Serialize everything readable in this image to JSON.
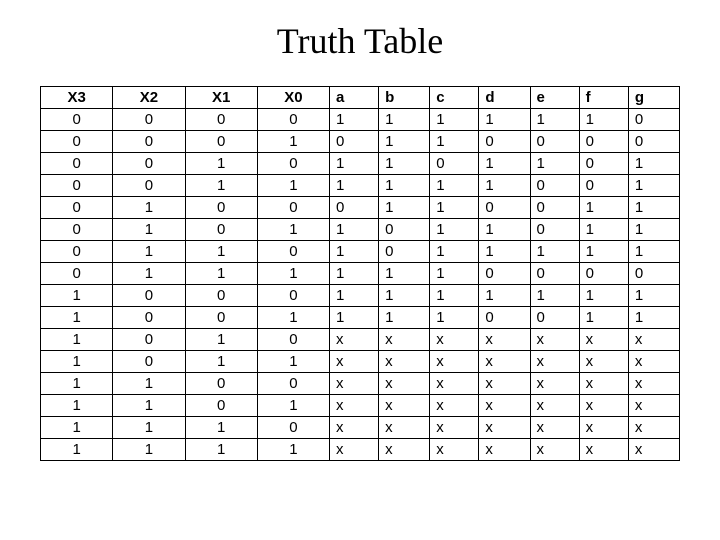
{
  "title": "Truth Table",
  "chart_data": {
    "type": "table",
    "headers": [
      "X3",
      "X2",
      "X1",
      "X0",
      "a",
      "b",
      "c",
      "d",
      "e",
      "f",
      "g"
    ],
    "rows": [
      [
        "0",
        "0",
        "0",
        "0",
        "1",
        "1",
        "1",
        "1",
        "1",
        "1",
        "0"
      ],
      [
        "0",
        "0",
        "0",
        "1",
        "0",
        "1",
        "1",
        "0",
        "0",
        "0",
        "0"
      ],
      [
        "0",
        "0",
        "1",
        "0",
        "1",
        "1",
        "0",
        "1",
        "1",
        "0",
        "1"
      ],
      [
        "0",
        "0",
        "1",
        "1",
        "1",
        "1",
        "1",
        "1",
        "0",
        "0",
        "1"
      ],
      [
        "0",
        "1",
        "0",
        "0",
        "0",
        "1",
        "1",
        "0",
        "0",
        "1",
        "1"
      ],
      [
        "0",
        "1",
        "0",
        "1",
        "1",
        "0",
        "1",
        "1",
        "0",
        "1",
        "1"
      ],
      [
        "0",
        "1",
        "1",
        "0",
        "1",
        "0",
        "1",
        "1",
        "1",
        "1",
        "1"
      ],
      [
        "0",
        "1",
        "1",
        "1",
        "1",
        "1",
        "1",
        "0",
        "0",
        "0",
        "0"
      ],
      [
        "1",
        "0",
        "0",
        "0",
        "1",
        "1",
        "1",
        "1",
        "1",
        "1",
        "1"
      ],
      [
        "1",
        "0",
        "0",
        "1",
        "1",
        "1",
        "1",
        "0",
        "0",
        "1",
        "1"
      ],
      [
        "1",
        "0",
        "1",
        "0",
        "x",
        "x",
        "x",
        "x",
        "x",
        "x",
        "x"
      ],
      [
        "1",
        "0",
        "1",
        "1",
        "x",
        "x",
        "x",
        "x",
        "x",
        "x",
        "x"
      ],
      [
        "1",
        "1",
        "0",
        "0",
        "x",
        "x",
        "x",
        "x",
        "x",
        "x",
        "x"
      ],
      [
        "1",
        "1",
        "0",
        "1",
        "x",
        "x",
        "x",
        "x",
        "x",
        "x",
        "x"
      ],
      [
        "1",
        "1",
        "1",
        "0",
        "x",
        "x",
        "x",
        "x",
        "x",
        "x",
        "x"
      ],
      [
        "1",
        "1",
        "1",
        "1",
        "x",
        "x",
        "x",
        "x",
        "x",
        "x",
        "x"
      ]
    ]
  }
}
